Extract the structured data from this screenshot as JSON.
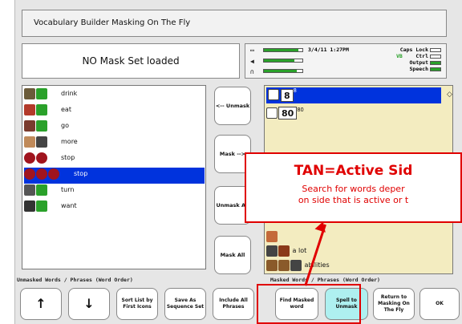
{
  "window_title": "Vocabulary Builder Masking On The Fly",
  "mask_status": "NO Mask Set loaded",
  "status": {
    "datetime": "3/4/11  1:27PM",
    "caps_lock": "Caps Lock",
    "ctrl": "Ctrl",
    "output": "Output",
    "speech": "Speech",
    "vb": "VB"
  },
  "left_list": {
    "items": [
      {
        "label": "drink"
      },
      {
        "label": "eat"
      },
      {
        "label": "go"
      },
      {
        "label": "more"
      },
      {
        "label": "stop"
      },
      {
        "label": "stop",
        "selected": true
      },
      {
        "label": "turn"
      },
      {
        "label": "want"
      }
    ],
    "caption": "Unmasked Words / Phrases (Word Order)"
  },
  "middle_buttons": {
    "unmask": "<-- Unmask",
    "mask": "Mask -->",
    "unmask_all": "Unmask All",
    "mask_all": "Mask All"
  },
  "right_list": {
    "items": [
      {
        "number": "8",
        "sup": "8"
      },
      {
        "number": "80",
        "sup": "80"
      },
      {
        "label": "a lot"
      },
      {
        "label": "abilities"
      }
    ],
    "caption": "Masked Words / Phrases (Word Order)"
  },
  "callout": {
    "heading": "TAN=Active Sid",
    "line1": "Search for words deper",
    "line2": "on side that is active or t"
  },
  "bottom_buttons": {
    "up": "↑",
    "down": "↓",
    "sort": "Sort List by First Icons",
    "save": "Save As Sequence Set",
    "include": "Include All Phrases",
    "find": "Find Masked word",
    "spell": "Spell to Unmask",
    "return": "Return to Masking On The Fly",
    "ok": "OK"
  },
  "colors": {
    "accent_green": "#2aa12a",
    "selection_blue": "#0033dd",
    "callout_red": "#e00000",
    "active_tan": "#f3ecc0",
    "cyan_button": "#aef0f0"
  }
}
